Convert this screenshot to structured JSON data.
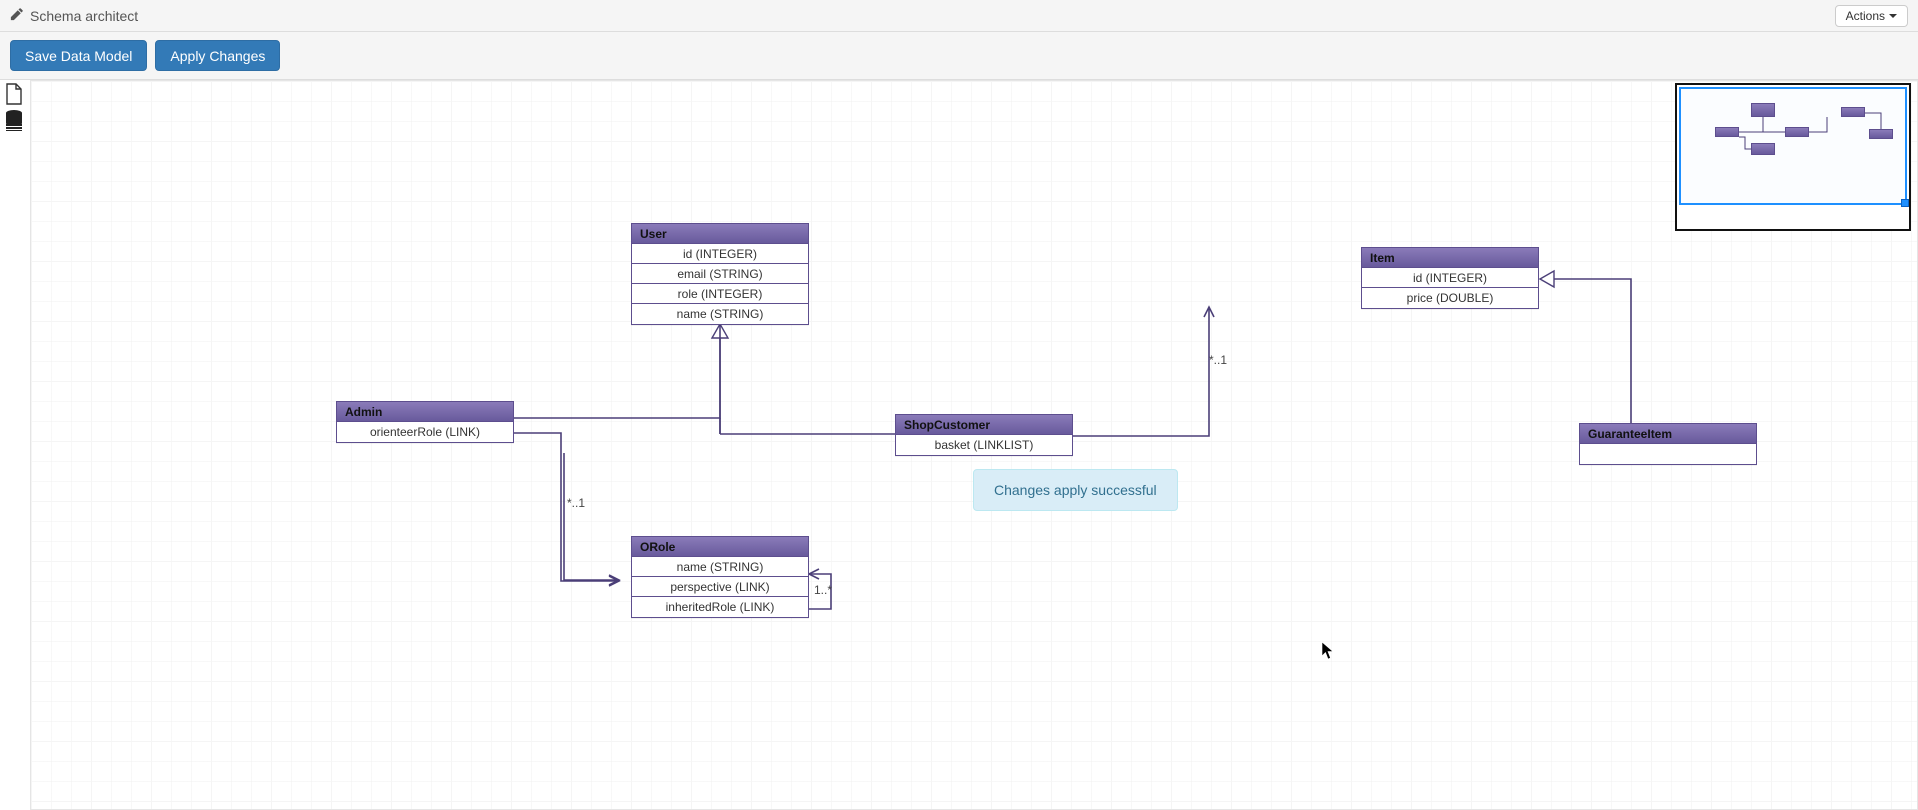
{
  "header": {
    "title": "Schema architect",
    "actions_label": "Actions"
  },
  "toolbar": {
    "save_label": "Save Data Model",
    "apply_label": "Apply Changes"
  },
  "toast": {
    "message": "Changes apply successful"
  },
  "entities": {
    "user": {
      "name": "User",
      "fields": [
        "id (INTEGER)",
        "email (STRING)",
        "role (INTEGER)",
        "name (STRING)"
      ]
    },
    "admin": {
      "name": "Admin",
      "fields": [
        "orienteerRole (LINK)"
      ]
    },
    "shopcustomer": {
      "name": "ShopCustomer",
      "fields": [
        "basket (LINKLIST)"
      ]
    },
    "orole": {
      "name": "ORole",
      "fields": [
        "name (STRING)",
        "perspective (LINK)",
        "inheritedRole (LINK)"
      ]
    },
    "item": {
      "name": "Item",
      "fields": [
        "id (INTEGER)",
        "price (DOUBLE)"
      ]
    },
    "guaranteeitem": {
      "name": "GuaranteeItem"
    }
  },
  "edge_labels": {
    "admin_orole": "*..1",
    "shopcustomer_item": "*..1",
    "orole_self": "1..*"
  },
  "palette": {
    "new_class": "new-class-icon",
    "existing_classes": "existing-classes-icon"
  }
}
